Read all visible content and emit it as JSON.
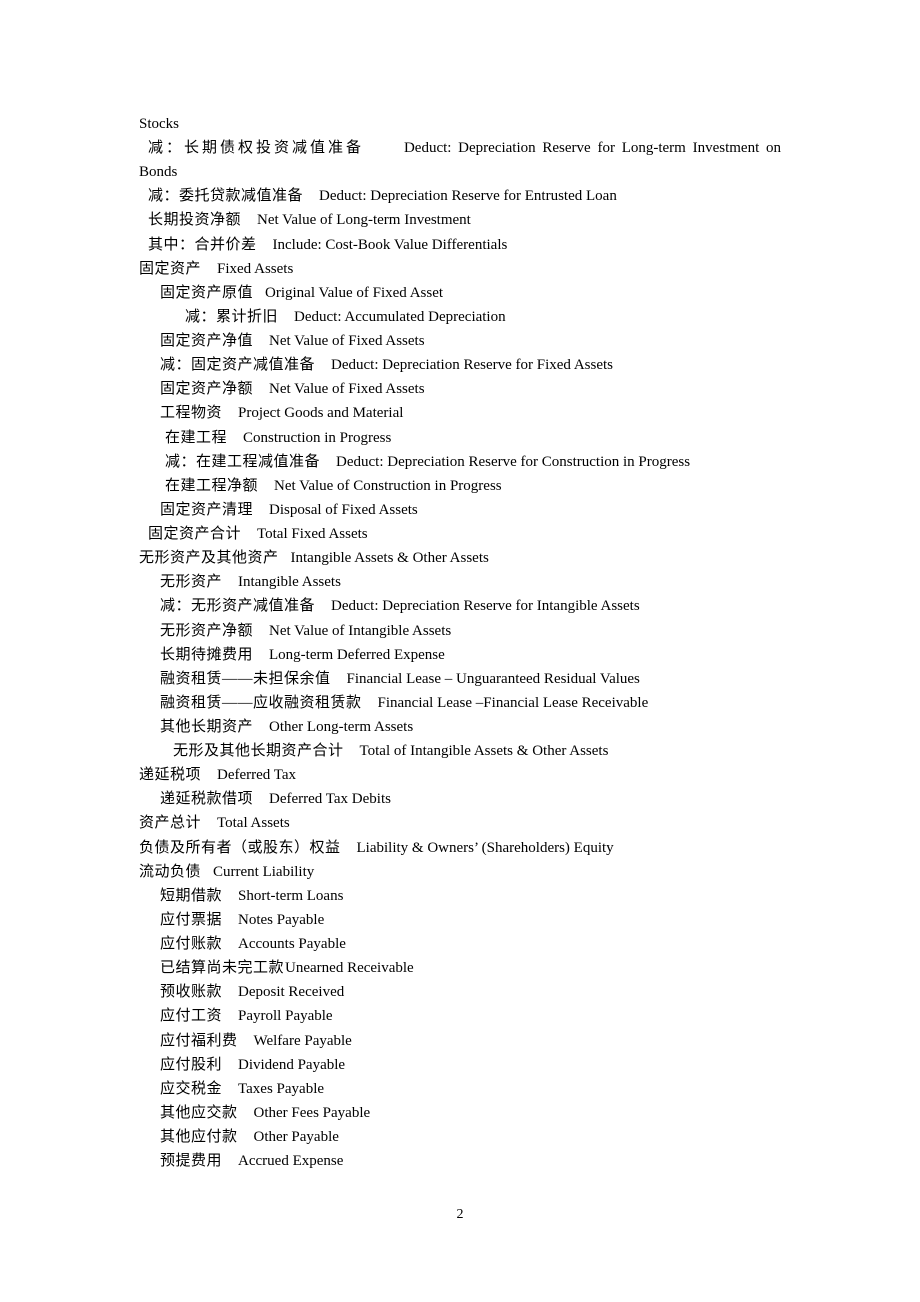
{
  "document": {
    "page_number": "2",
    "lines": [
      {
        "zh": "",
        "en": "Stocks"
      },
      {
        "zh": "减：长期债权投资减值准备",
        "en": "Deduct: Depreciation Reserve for Long-term Investment on"
      },
      {
        "zh": "",
        "en": "Bonds"
      },
      {
        "zh": "减：委托贷款减值准备",
        "en": "Deduct: Depreciation Reserve for Entrusted Loan"
      },
      {
        "zh": "长期投资净额",
        "en": "Net Value of Long-term Investment"
      },
      {
        "zh": "其中：合并价差",
        "en": "Include: Cost-Book Value Differentials"
      },
      {
        "zh": "固定资产",
        "en": "Fixed Assets"
      },
      {
        "zh": "固定资产原值",
        "en": "Original Value of Fixed Asset"
      },
      {
        "zh": "减：累计折旧",
        "en": "Deduct: Accumulated Depreciation"
      },
      {
        "zh": "固定资产净值",
        "en": "Net Value of Fixed Assets"
      },
      {
        "zh": "减：固定资产减值准备",
        "en": "Deduct: Depreciation Reserve for Fixed Assets"
      },
      {
        "zh": "固定资产净额",
        "en": "Net Value of Fixed Assets"
      },
      {
        "zh": "工程物资",
        "en": "Project Goods and Material"
      },
      {
        "zh": "在建工程",
        "en": "Construction in Progress"
      },
      {
        "zh": "减：在建工程减值准备",
        "en": "Deduct: Depreciation Reserve for Construction in Progress"
      },
      {
        "zh": "在建工程净额",
        "en": "Net Value of Construction in Progress"
      },
      {
        "zh": "固定资产清理",
        "en": "Disposal of Fixed Assets"
      },
      {
        "zh": "固定资产合计",
        "en": "Total Fixed Assets"
      },
      {
        "zh": "无形资产及其他资产",
        "en": "Intangible Assets & Other Assets"
      },
      {
        "zh": "无形资产",
        "en": "Intangible Assets"
      },
      {
        "zh": "减：无形资产减值准备",
        "en": "Deduct: Depreciation Reserve for Intangible Assets"
      },
      {
        "zh": "无形资产净额",
        "en": "Net Value of Intangible Assets"
      },
      {
        "zh": "长期待摊费用",
        "en": "Long-term Deferred Expense"
      },
      {
        "zh": "融资租赁——未担保余值",
        "en": "Financial Lease – Unguaranteed Residual Values"
      },
      {
        "zh": "融资租赁——应收融资租赁款",
        "en": "Financial Lease –Financial Lease Receivable"
      },
      {
        "zh": "其他长期资产",
        "en": "Other Long-term Assets"
      },
      {
        "zh": "无形及其他长期资产合计",
        "en": "Total of Intangible Assets & Other Assets"
      },
      {
        "zh": "递延税项",
        "en": "Deferred Tax"
      },
      {
        "zh": "递延税款借项",
        "en": "Deferred Tax Debits"
      },
      {
        "zh": "资产总计",
        "en": "Total Assets"
      },
      {
        "zh": "负债及所有者（或股东）权益",
        "en": "Liability & Owners’ (Shareholders) Equity"
      },
      {
        "zh": "流动负债",
        "en": "Current Liability"
      },
      {
        "zh": "短期借款",
        "en": "Short-term Loans"
      },
      {
        "zh": "应付票据",
        "en": "Notes Payable"
      },
      {
        "zh": "应付账款",
        "en": "Accounts Payable"
      },
      {
        "zh": "已结算尚未完工款",
        "en": "Unearned Receivable"
      },
      {
        "zh": "预收账款",
        "en": "Deposit Received"
      },
      {
        "zh": "应付工资",
        "en": "Payroll Payable"
      },
      {
        "zh": "应付福利费",
        "en": "Welfare Payable"
      },
      {
        "zh": "应付股利",
        "en": "Dividend Payable"
      },
      {
        "zh": "应交税金",
        "en": "Taxes Payable"
      },
      {
        "zh": "其他应交款",
        "en": "Other Fees Payable"
      },
      {
        "zh": "其他应付款",
        "en": "Other Payable"
      },
      {
        "zh": "预提费用",
        "en": "Accrued Expense"
      }
    ]
  }
}
